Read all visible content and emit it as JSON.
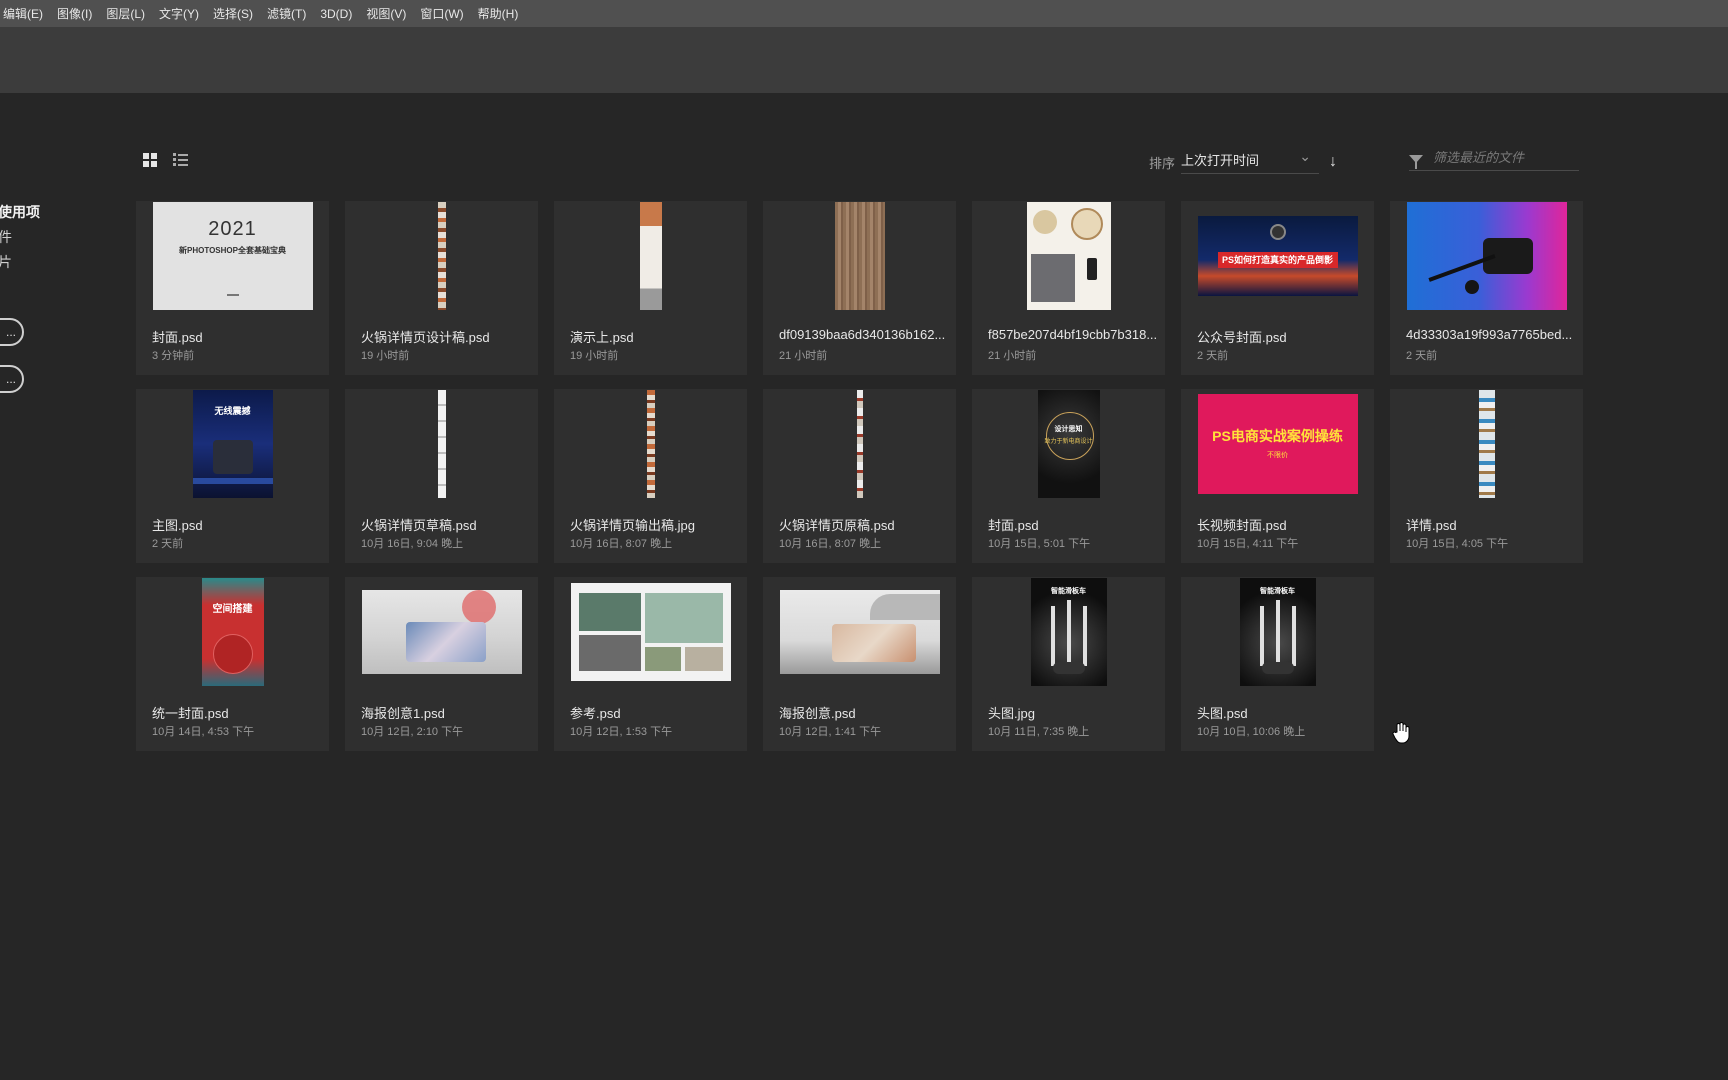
{
  "menu": [
    "编辑(E)",
    "图像(I)",
    "图层(L)",
    "文字(Y)",
    "选择(S)",
    "滤镜(T)",
    "3D(D)",
    "视图(V)",
    "窗口(W)",
    "帮助(H)"
  ],
  "left_nav": {
    "items": [
      "使用项",
      "件",
      "片"
    ],
    "buttons": [
      "...",
      "..."
    ]
  },
  "sort": {
    "label": "排序",
    "value": "上次打开时间",
    "chevron": "chevron-down-icon",
    "direction_icon": "arrow-down-icon"
  },
  "filter": {
    "placeholder": "筛选最近的文件",
    "icon": "filter-icon"
  },
  "thumb_text": {
    "cover_year": "2021",
    "cover_sub": "新PHOTOSHOP全套基础宝典",
    "gzh_banner": "PS如何打造真实的产品倒影",
    "main_poster_title": "无线震撼",
    "cover2_line1": "设计思知",
    "cover2_line2": "致力于新电商设计",
    "longvideo_title": "PS电商实战案例操练",
    "longvideo_sub": "不限价",
    "unify_title": "空间搭建",
    "scooter_title": "智能滑板车"
  },
  "files": [
    {
      "name": "封面.psd",
      "time": "3 分钟前"
    },
    {
      "name": "火锅详情页设计稿.psd",
      "time": "19 小时前"
    },
    {
      "name": "演示上.psd",
      "time": "19 小时前"
    },
    {
      "name": "df09139baa6d340136b162...",
      "time": "21 小时前"
    },
    {
      "name": "f857be207d4bf19cbb7b318...",
      "time": "21 小时前"
    },
    {
      "name": "公众号封面.psd",
      "time": "2 天前"
    },
    {
      "name": "4d33303a19f993a7765bed...",
      "time": "2 天前"
    },
    {
      "name": "主图.psd",
      "time": "2 天前"
    },
    {
      "name": "火锅详情页草稿.psd",
      "time": "10月 16日, 9:04 晚上"
    },
    {
      "name": "火锅详情页输出稿.jpg",
      "time": "10月 16日, 8:07 晚上"
    },
    {
      "name": "火锅详情页原稿.psd",
      "time": "10月 16日, 8:07 晚上"
    },
    {
      "name": "封面.psd",
      "time": "10月 15日, 5:01 下午"
    },
    {
      "name": "长视频封面.psd",
      "time": "10月 15日, 4:11 下午"
    },
    {
      "name": "详情.psd",
      "time": "10月 15日, 4:05 下午"
    },
    {
      "name": "统一封面.psd",
      "time": "10月 14日, 4:53 下午"
    },
    {
      "name": "海报创意1.psd",
      "time": "10月 12日, 2:10 下午"
    },
    {
      "name": "参考.psd",
      "time": "10月 12日, 1:53 下午"
    },
    {
      "name": "海报创意.psd",
      "time": "10月 12日, 1:41 下午"
    },
    {
      "name": "头图.jpg",
      "time": "10月 11日, 7:35 晚上"
    },
    {
      "name": "头图.psd",
      "time": "10月 10日, 10:06 晚上"
    }
  ],
  "colors": {
    "background": "#262626",
    "card": "#2f2f2f",
    "menubar": "#505050",
    "optionsbar": "#3c3c3c",
    "accent_pink": "#e0195c"
  }
}
